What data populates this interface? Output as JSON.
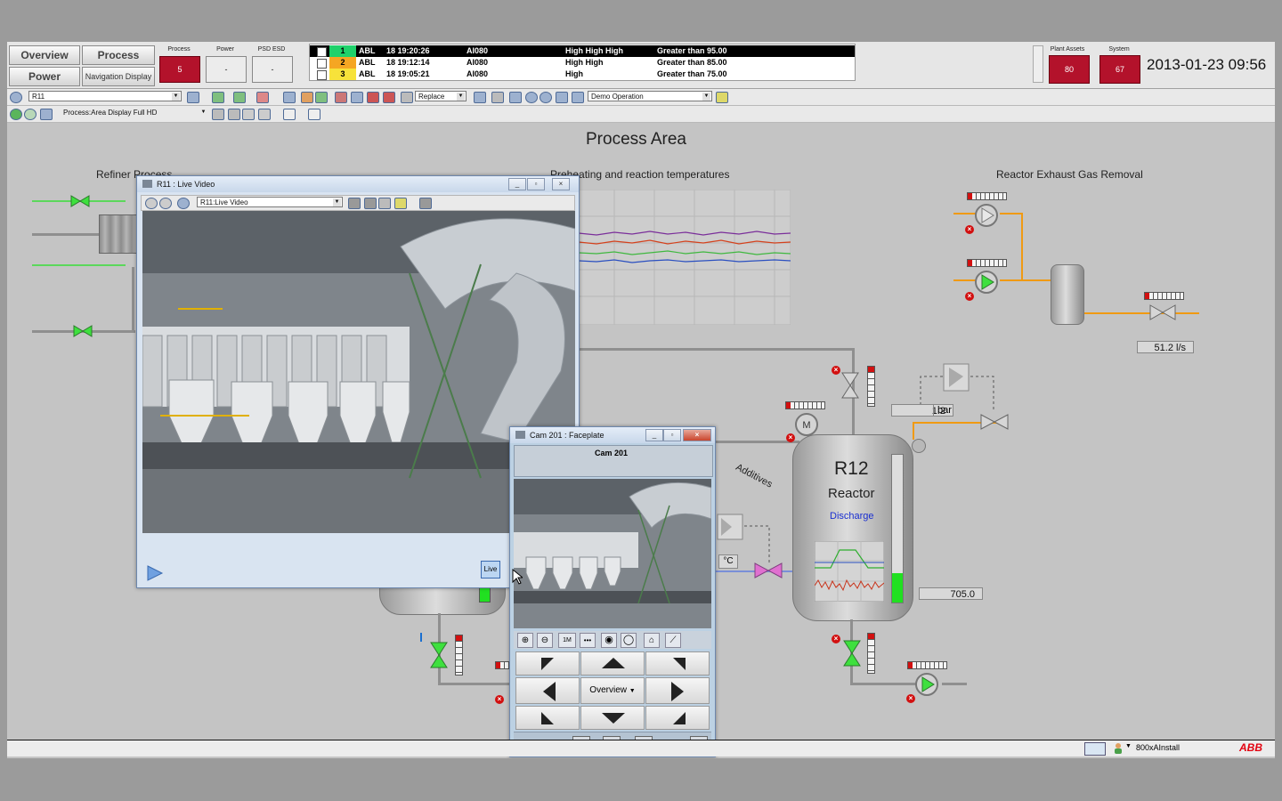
{
  "nav": {
    "overview": "Overview",
    "process": "Process",
    "power": "Power",
    "navigation_display": "Navigation Display"
  },
  "indicators": [
    {
      "label": "Process",
      "value": "5"
    },
    {
      "label": "Power",
      "value": "-"
    },
    {
      "label": "PSD ESD",
      "value": "-"
    }
  ],
  "alarms": [
    {
      "num": "1",
      "obj": "ABL",
      "time": "18 19:20:26",
      "tag": "AI080",
      "cond": "High High High",
      "desc": "Greater than 95.00"
    },
    {
      "num": "2",
      "obj": "ABL",
      "time": "18 19:12:14",
      "tag": "AI080",
      "cond": "High High",
      "desc": "Greater than 85.00"
    },
    {
      "num": "3",
      "obj": "ABL",
      "time": "18 19:05:21",
      "tag": "AI080",
      "cond": "High",
      "desc": "Greater than 75.00"
    }
  ],
  "status": [
    {
      "label": "Plant Assets",
      "value": "80"
    },
    {
      "label": "System",
      "value": "67"
    }
  ],
  "clock": "2013-01-23 09:56",
  "toolbar1": {
    "object": "R11",
    "mode": "Replace",
    "workplace": "Demo Operation"
  },
  "toolbar2": {
    "display": "Process:Area Display Full HD"
  },
  "canvas": {
    "title": "Process Area",
    "refiner_title": "Refiner Process",
    "temps_title": "Preheating and reaction temperatures",
    "exhaust_title": "Reactor Exhaust Gas Removal",
    "flow_value": "51.2 l/s",
    "pressure_value": "1.2",
    "pressure_unit": "bar",
    "additives": "Additives",
    "temp_unit": "°C",
    "reactor_id": "R12",
    "reactor_name": "Reactor",
    "discharge": "Discharge",
    "reactor_value": "705.0"
  },
  "video_window": {
    "title": "R11 : Live Video",
    "path": "R11:Live Video",
    "live_label": "Live"
  },
  "faceplate": {
    "title": "Cam 201 : Faceplate",
    "header": "Cam 201",
    "zoom_label": "1M",
    "overview": "Overview"
  },
  "taskbar": {
    "user": "800xAInstall",
    "brand": "ABB"
  },
  "colors": {
    "alarm_red": "#b3122b",
    "pipe_orange": "#f09a12",
    "flow_green": "#5bd85b",
    "valve_pink": "#e070d0"
  }
}
